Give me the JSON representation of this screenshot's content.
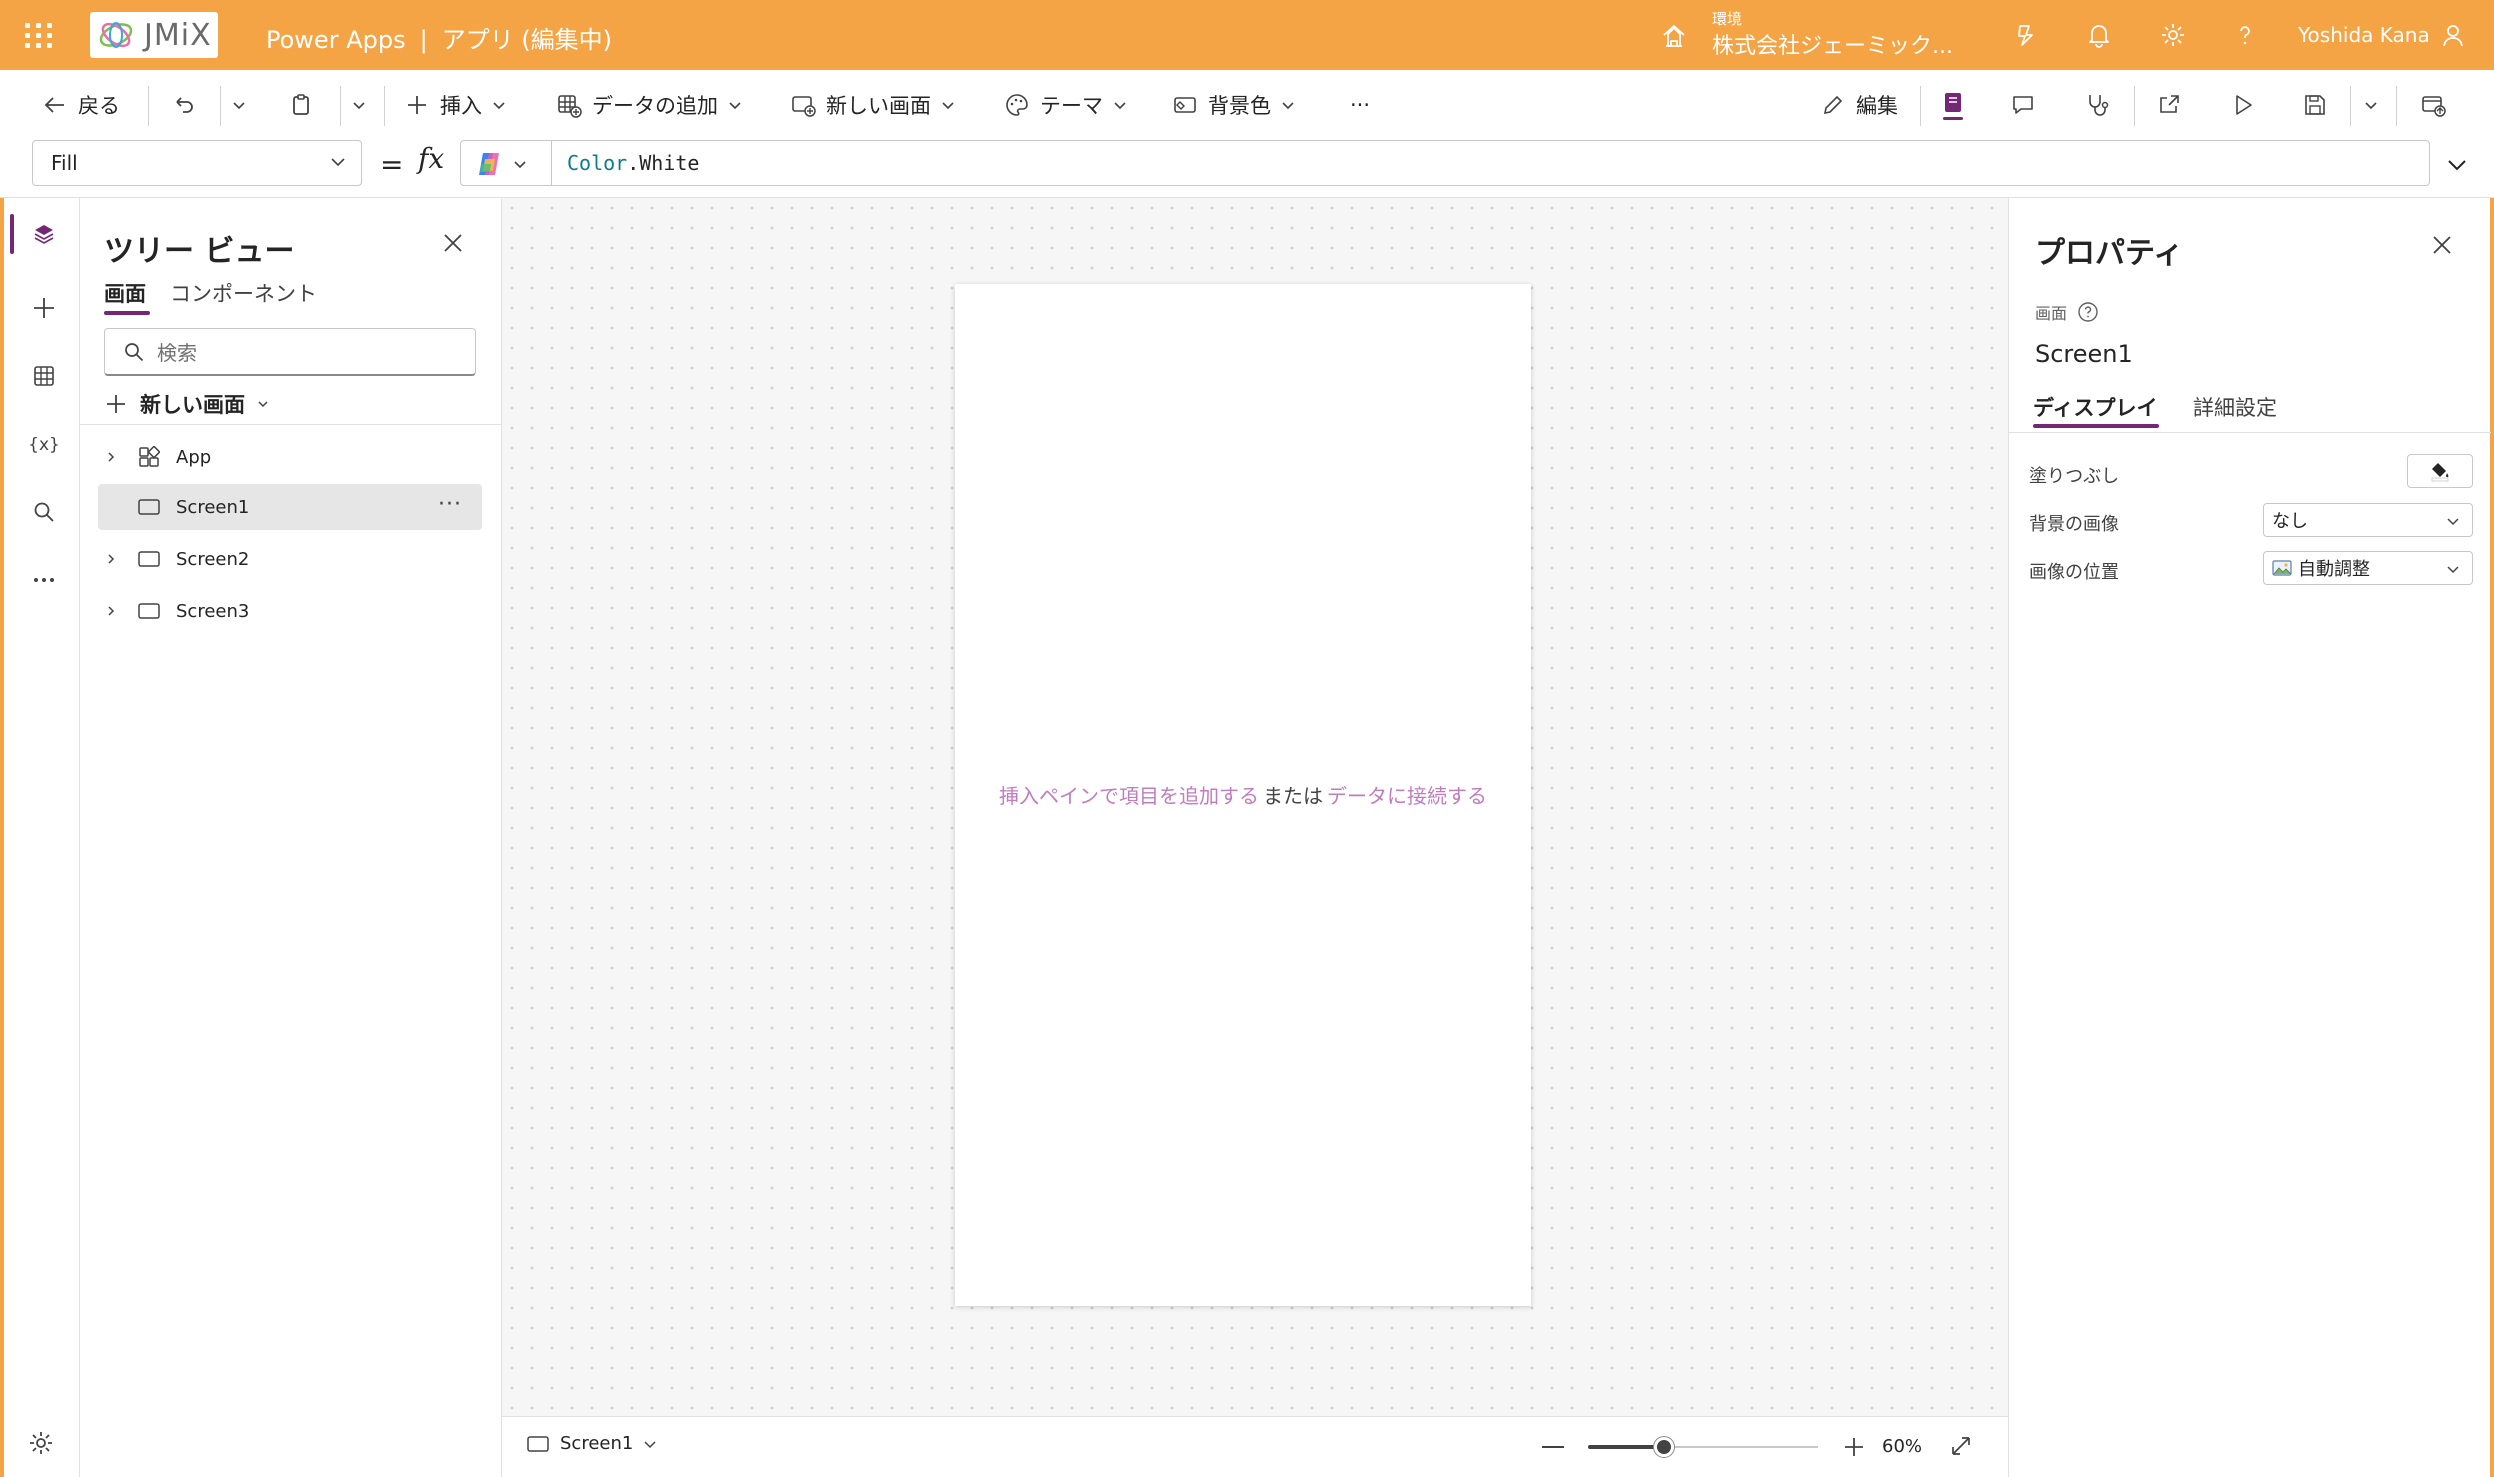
{
  "header": {
    "logo_text": "JMiX",
    "app_name": "Power Apps",
    "separator": "|",
    "app_title": "アプリ (編集中)",
    "environment_label": "環境",
    "environment_name": "株式会社ジェーミック...",
    "user_name": "Yoshida Kana",
    "accent_color": "#f4a445"
  },
  "commandbar": {
    "back": "戻る",
    "insert": "挿入",
    "add_data": "データの追加",
    "new_screen": "新しい画面",
    "theme": "テーマ",
    "background_color": "背景色",
    "more": "···",
    "edit": "編集"
  },
  "formula": {
    "property": "Fill",
    "equals": "=",
    "fx": "fx",
    "token_ns": "Color",
    "token_dot": ".",
    "token_member": "White"
  },
  "tree": {
    "title": "ツリー ビュー",
    "tab_screens": "画面",
    "tab_components": "コンポーネント",
    "search_placeholder": "検索",
    "new_screen": "新しい画面",
    "items": [
      {
        "label": "App",
        "expandable": true,
        "selected": false
      },
      {
        "label": "Screen1",
        "expandable": false,
        "selected": true
      },
      {
        "label": "Screen2",
        "expandable": true,
        "selected": false
      },
      {
        "label": "Screen3",
        "expandable": true,
        "selected": false
      }
    ],
    "more": "···"
  },
  "canvas": {
    "hint_link1": "挿入ペインで項目を追加する",
    "hint_mid": "または",
    "hint_link2": "データに接続する"
  },
  "status": {
    "screen": "Screen1",
    "zoom": "60%",
    "zoom_level": 0.3
  },
  "properties": {
    "title": "プロパティ",
    "crumb": "画面",
    "control_name": "Screen1",
    "tab_display": "ディスプレイ",
    "tab_advanced": "詳細設定",
    "fill_label": "塗りつぶし",
    "bg_image_label": "背景の画像",
    "bg_image_value": "なし",
    "image_position_label": "画像の位置",
    "image_position_value": "自動調整",
    "fill_value": "White"
  }
}
